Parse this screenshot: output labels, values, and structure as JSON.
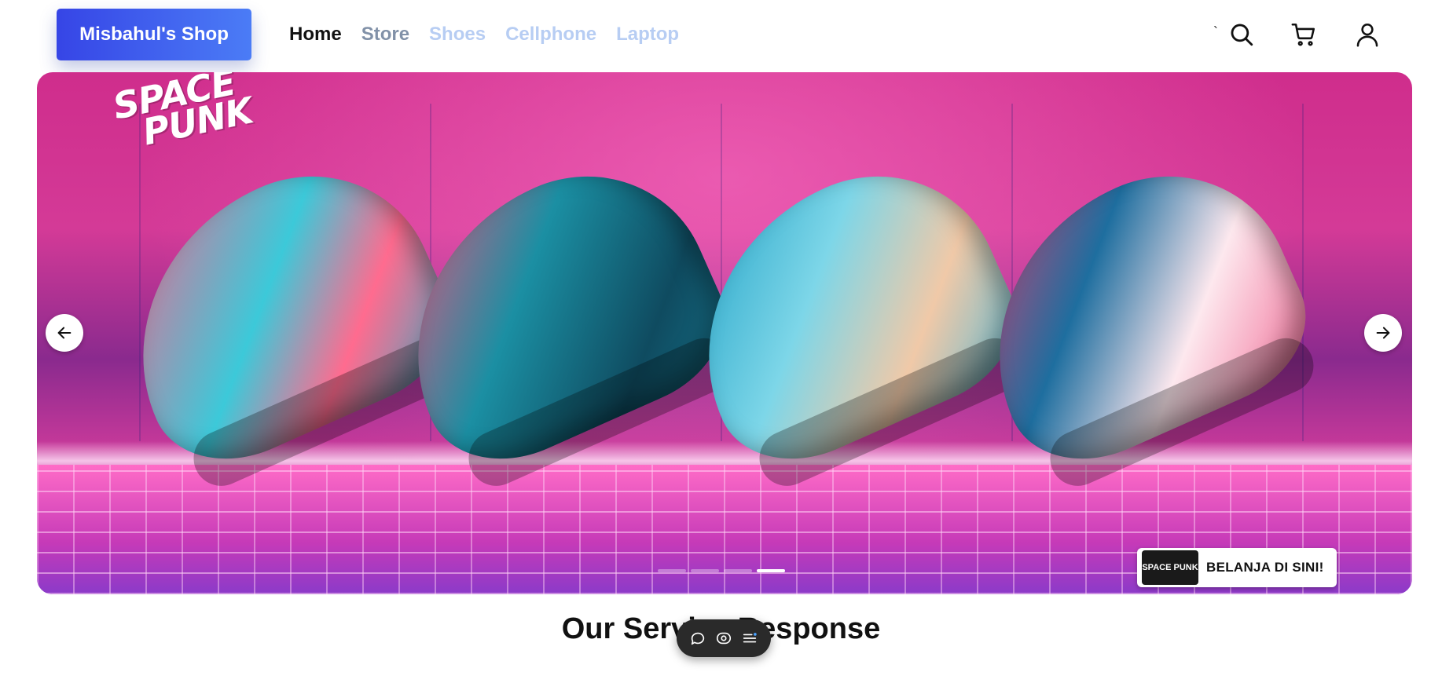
{
  "header": {
    "brand": "Misbahul's Shop",
    "nav": {
      "home": "Home",
      "store": "Store",
      "shoes": "Shoes",
      "cellphone": "Cellphone",
      "laptop": "Laptop"
    },
    "stray_char": "`",
    "icons": {
      "search": "search-icon",
      "cart": "cart-icon",
      "account": "user-icon"
    }
  },
  "banner": {
    "logo_line1": "SPACE",
    "logo_line2": "PUNK",
    "badge_logo": "SPACE PUNK",
    "badge_text": "BELANJA DI SINI!",
    "slides_count": 4,
    "active_slide": 4,
    "colors": {
      "primary": "#d43a97",
      "accent": "#3cc9d9"
    }
  },
  "section": {
    "title": "Our Service Response"
  },
  "float_toolbar": {
    "icons": [
      "chat-icon",
      "eye-icon",
      "list-icon"
    ]
  },
  "colors": {
    "brand_gradient_start": "#3645e6",
    "brand_gradient_end": "#4b7cf6",
    "nav_active": "#111111",
    "nav_muted": "#8191a8",
    "nav_faded": "#b7cdf3"
  }
}
